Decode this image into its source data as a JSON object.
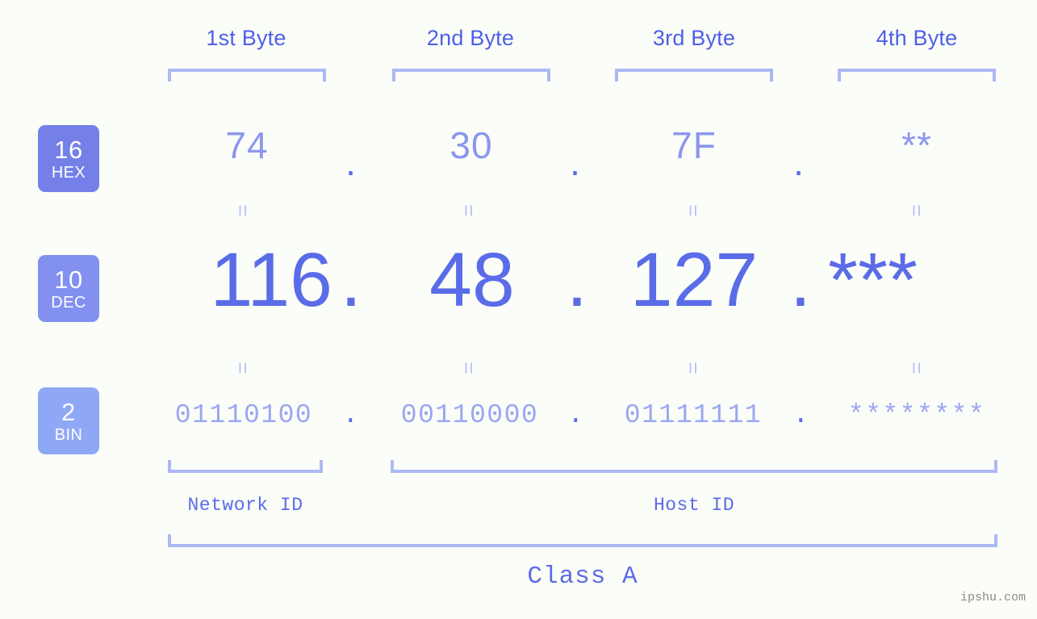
{
  "meta": {
    "background_color": "#fbfdf8",
    "accent_strong": "#5a6ce8",
    "accent_mid": "#8b96ee",
    "accent_light": "#adb8f5",
    "watermark": "ipshu.com"
  },
  "headers": [
    {
      "label": "1st Byte"
    },
    {
      "label": "2nd Byte"
    },
    {
      "label": "3rd Byte"
    },
    {
      "label": "4th Byte"
    }
  ],
  "radix_badges": [
    {
      "number": "16",
      "name": "HEX",
      "color": "#7480e8"
    },
    {
      "number": "10",
      "name": "DEC",
      "color": "#8290f0"
    },
    {
      "number": "2",
      "name": "BIN",
      "color": "#8fa8f5"
    }
  ],
  "rows": {
    "hex": {
      "radix": "16",
      "radix_name": "HEX",
      "values": [
        "74",
        "30",
        "7F",
        "**"
      ],
      "separators": [
        ".",
        ".",
        "."
      ]
    },
    "dec": {
      "radix": "10",
      "radix_name": "DEC",
      "values": [
        "116",
        "48",
        "127",
        "***"
      ],
      "separators": [
        ".",
        ".",
        "."
      ]
    },
    "bin": {
      "radix": "2",
      "radix_name": "BIN",
      "values": [
        "01110100",
        "00110000",
        "01111111",
        "********"
      ],
      "separators": [
        ".",
        ".",
        "."
      ]
    }
  },
  "equality_markers": {
    "glyph": "=",
    "count_per_gap": 4,
    "gaps": [
      "hex-to-dec",
      "dec-to-bin"
    ]
  },
  "id_sections": [
    {
      "label": "Network ID",
      "bytes": [
        "1st Byte"
      ]
    },
    {
      "label": "Host ID",
      "bytes": [
        "2nd Byte",
        "3rd Byte",
        "4th Byte"
      ]
    }
  ],
  "class": {
    "label": "Class A"
  }
}
